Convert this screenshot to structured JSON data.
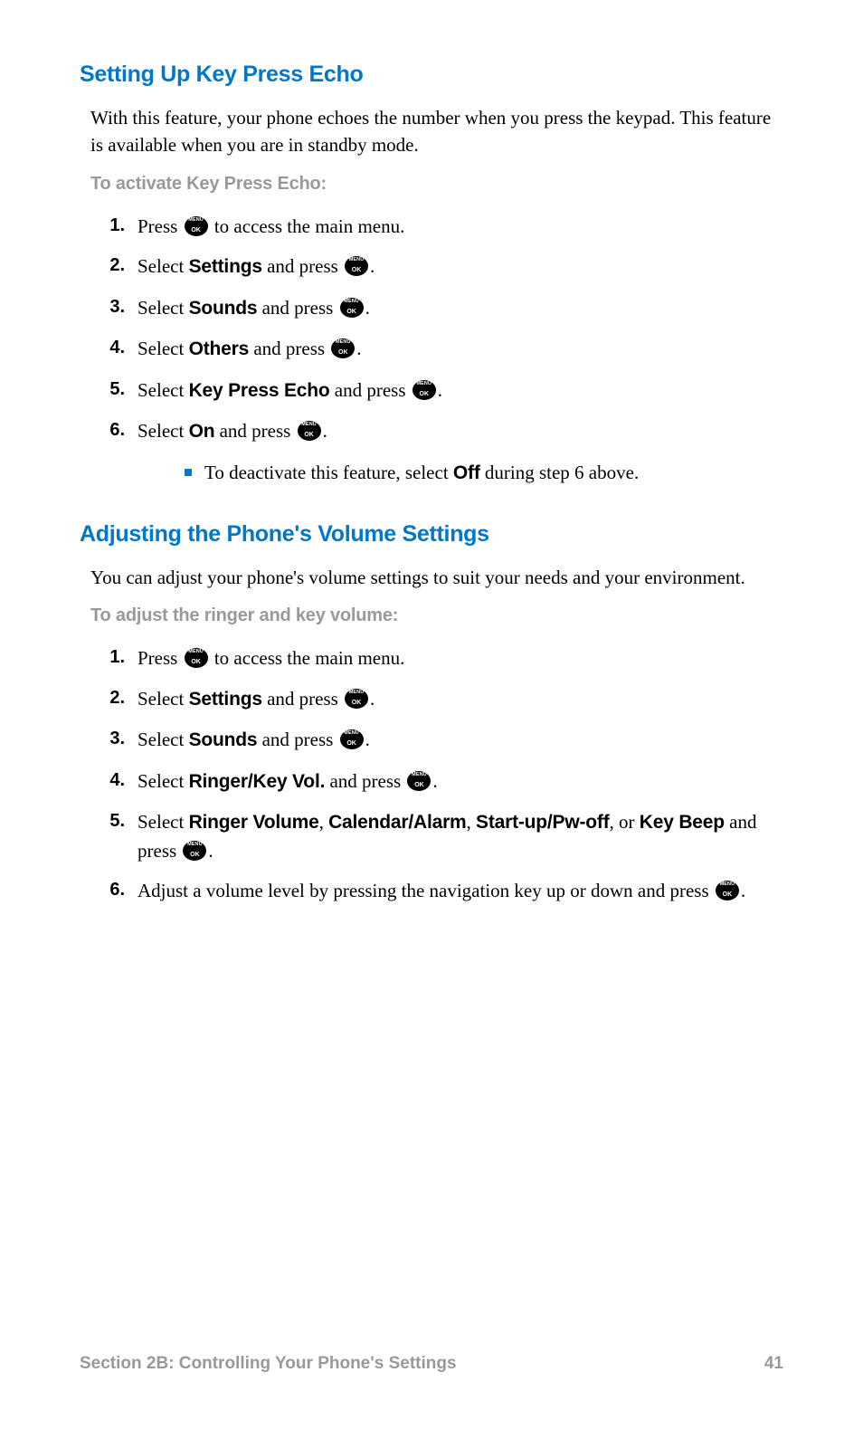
{
  "section1": {
    "title": "Setting Up Key Press Echo",
    "intro": "With this feature, your phone echoes the number when you press the keypad. This feature is available when you are in standby mode.",
    "subhead": "To activate Key Press Echo:",
    "steps": {
      "s1_a": "Press ",
      "s1_b": " to access the main menu.",
      "s2_a": "Select ",
      "s2_bold": "Settings",
      "s2_b": " and press ",
      "s2_c": ".",
      "s3_a": "Select ",
      "s3_bold": "Sounds",
      "s3_b": " and press ",
      "s3_c": ".",
      "s4_a": "Select ",
      "s4_bold": "Others",
      "s4_b": " and press ",
      "s4_c": ".",
      "s5_a": "Select ",
      "s5_bold": "Key Press Echo",
      "s5_b": " and press ",
      "s5_c": ".",
      "s6_a": "Select ",
      "s6_bold": "On",
      "s6_b": " and press ",
      "s6_c": ".",
      "sub_a": "To deactivate this feature, select ",
      "sub_bold": "Off",
      "sub_b": " during step 6 above."
    }
  },
  "section2": {
    "title": "Adjusting the Phone's Volume Settings",
    "intro": "You can adjust your phone's volume settings to suit your needs and your environment.",
    "subhead": "To adjust the ringer and key volume:",
    "steps": {
      "s1_a": "Press ",
      "s1_b": " to access the main menu.",
      "s2_a": "Select ",
      "s2_bold": "Settings",
      "s2_b": " and press ",
      "s2_c": ".",
      "s3_a": "Select ",
      "s3_bold": "Sounds",
      "s3_b": " and press ",
      "s3_c": ".",
      "s4_a": "Select ",
      "s4_bold": "Ringer/Key Vol.",
      "s4_b": " and press ",
      "s4_c": ".",
      "s5_a": "Select ",
      "s5_b1": "Ringer Volume",
      "s5_c1": ", ",
      "s5_b2": "Calendar/Alarm",
      "s5_c2": ", ",
      "s5_b3": "Start-up/Pw-off",
      "s5_c3": ", or ",
      "s5_b4": "Key Beep",
      "s5_d": " and press ",
      "s5_e": ".",
      "s6_a": "Adjust a volume level by pressing the navigation key up or down and press ",
      "s6_b": "."
    }
  },
  "footer": {
    "label": "Section 2B: Controlling Your Phone's Settings",
    "page": "41"
  }
}
